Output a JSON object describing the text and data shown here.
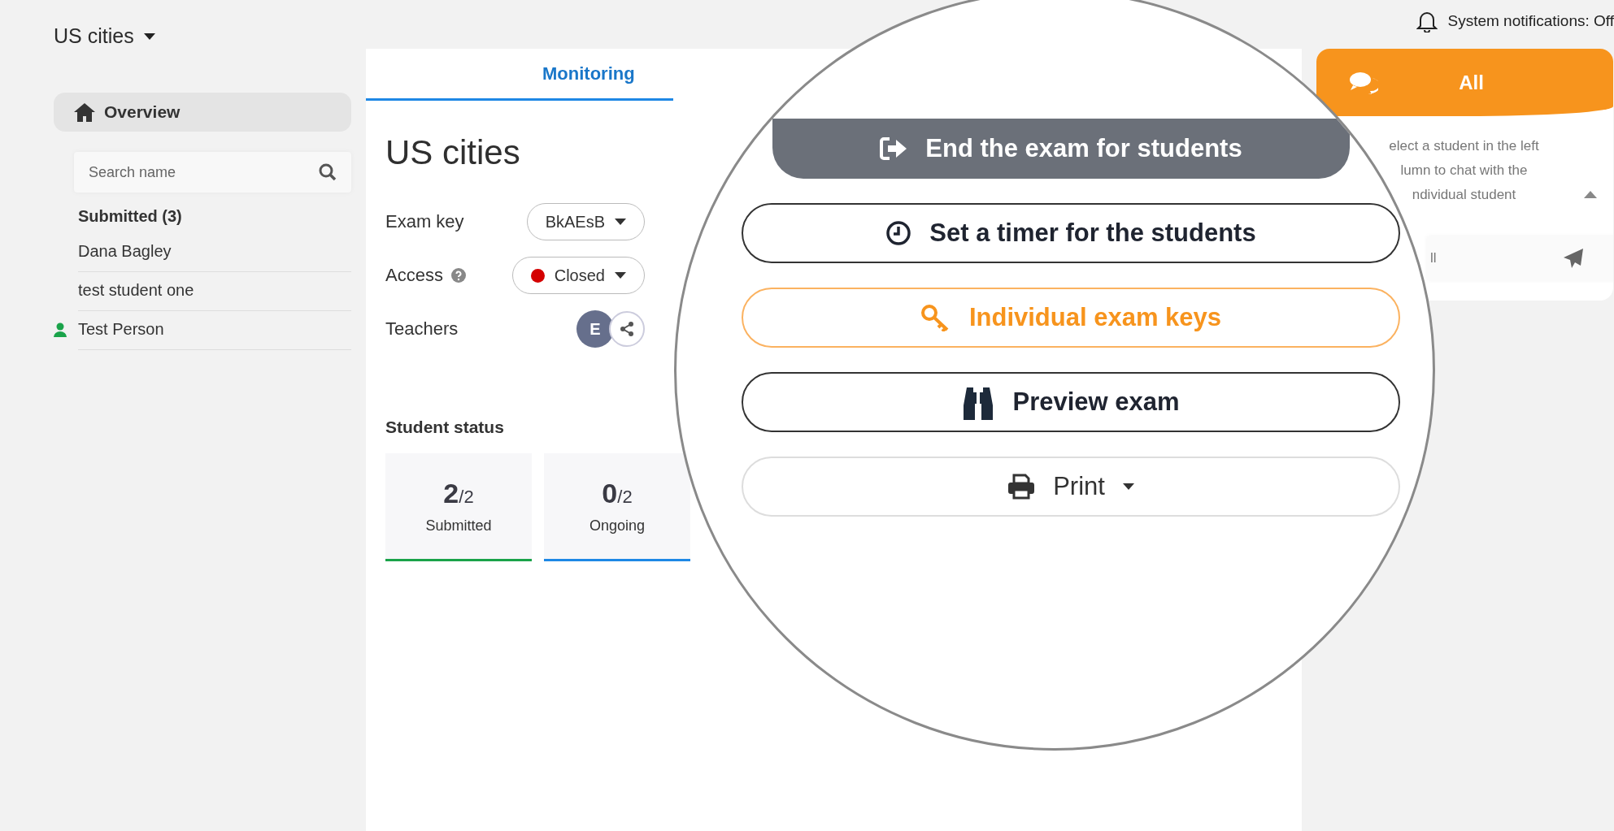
{
  "exam_switcher": {
    "label": "US cities"
  },
  "notifications": {
    "label": "System notifications: Off"
  },
  "sidebar": {
    "overview": {
      "label": "Overview",
      "selected": true
    },
    "search": {
      "placeholder": "Search name"
    },
    "group_title": "Submitted (3)",
    "students": [
      {
        "name": "Dana Bagley",
        "online": false
      },
      {
        "name": "test student one",
        "online": false
      },
      {
        "name": "Test Person",
        "online": true
      }
    ]
  },
  "main": {
    "tabs": [
      {
        "label": "Monitoring",
        "selected": true
      }
    ],
    "title": "US cities",
    "fields": [
      {
        "kind": "dropdown",
        "label": "Exam key",
        "help": false,
        "value": "BkAEsB"
      },
      {
        "kind": "status",
        "label": "Access",
        "help": true,
        "value": "Closed",
        "color": "#d40000"
      },
      {
        "kind": "avatars",
        "label": "Teachers",
        "help": false,
        "initial": "E"
      }
    ],
    "status_title": "Student status",
    "status_cards": [
      {
        "count": "2",
        "total": "/2",
        "label": "Submitted",
        "color": "#1aa34a"
      },
      {
        "count": "0",
        "total": "/2",
        "label": "Ongoing",
        "color": "#1e88e5"
      }
    ]
  },
  "magnifier": {
    "actions": [
      {
        "kind": "primary",
        "label": "End the exam for students"
      },
      {
        "kind": "outline",
        "label": "Set a timer for the students"
      },
      {
        "kind": "highlight",
        "label": "Individual exam keys"
      },
      {
        "kind": "outline",
        "label": "Preview exam"
      },
      {
        "kind": "menu",
        "label": "Print"
      }
    ]
  },
  "chat": {
    "title": "All",
    "hint_lines": [
      "elect a student in the left",
      "lumn to chat with the",
      "ndividual student"
    ],
    "input": {
      "placeholder": "ll"
    }
  }
}
